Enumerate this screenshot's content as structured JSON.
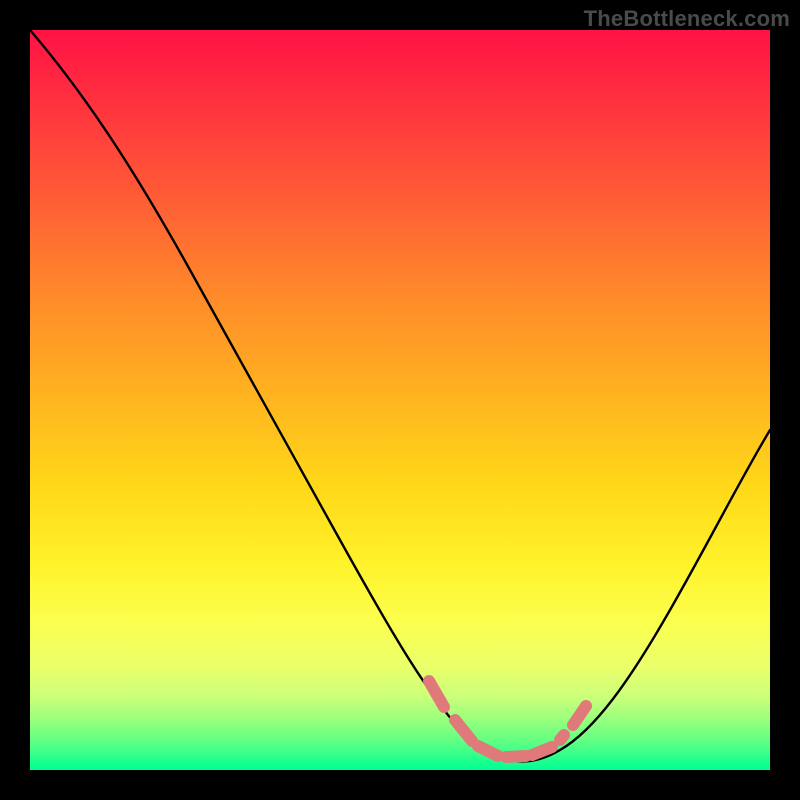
{
  "watermark": {
    "text": "TheBottleneck.com"
  },
  "colors": {
    "page_bg": "#000000",
    "curve_stroke": "#000000",
    "marker_stroke": "#e07a7a",
    "gradient_top": "#ff1245",
    "gradient_bottom": "#00ff96"
  },
  "chart_data": {
    "type": "line",
    "title": "",
    "xlabel": "",
    "ylabel": "",
    "xlim": [
      0,
      100
    ],
    "ylim": [
      0,
      100
    ],
    "grid": false,
    "legend": false,
    "series": [
      {
        "name": "bottleneck-curve",
        "x": [
          0,
          5,
          10,
          15,
          20,
          25,
          30,
          35,
          40,
          45,
          50,
          55,
          58,
          61,
          64,
          67,
          70,
          73,
          76,
          80,
          84,
          88,
          92,
          96,
          100
        ],
        "values": [
          100,
          91,
          82,
          74,
          66,
          58,
          50,
          43,
          36,
          29,
          22,
          14,
          9,
          5,
          2,
          1,
          1,
          2,
          4,
          8,
          14,
          22,
          31,
          41,
          52
        ]
      }
    ],
    "annotations": [
      {
        "name": "valley-markers",
        "x": [
          55,
          58,
          60,
          63,
          66,
          69,
          72,
          73
        ],
        "y": [
          13,
          8,
          5,
          3,
          2,
          2,
          3,
          5
        ]
      }
    ]
  }
}
